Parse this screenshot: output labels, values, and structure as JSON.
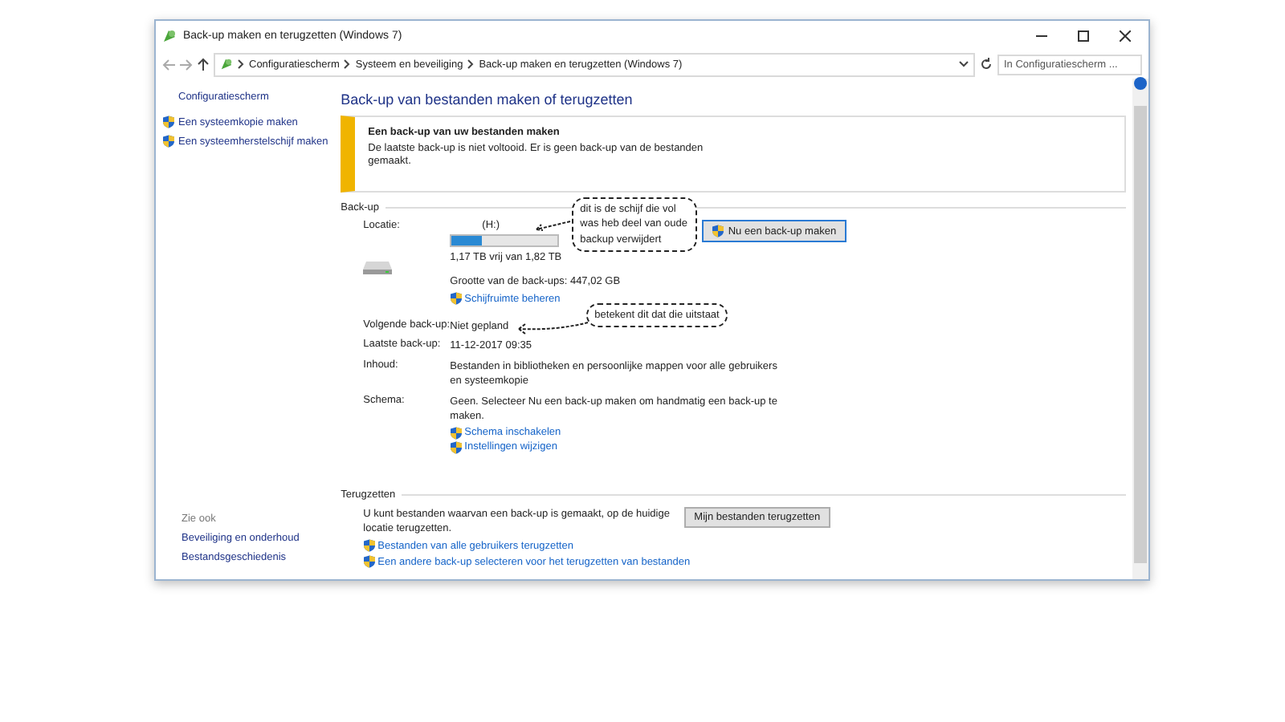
{
  "window": {
    "title": "Back-up maken en terugzetten (Windows 7)"
  },
  "address_bar": {
    "breadcrumbs": [
      "Configuratiescherm",
      "Systeem en beveiliging",
      "Back-up maken en terugzetten (Windows 7)"
    ],
    "search": {
      "placeholder": "In Configuratiescherm ..."
    }
  },
  "sidebar": {
    "home_link": "Configuratiescherm",
    "tasks": [
      "Een systeemkopie maken",
      "Een systeemherstelschijf maken"
    ],
    "see_also": {
      "heading": "Zie ook",
      "links": [
        "Beveiliging en onderhoud",
        "Bestandsgeschiedenis"
      ]
    }
  },
  "main": {
    "heading": "Back-up van bestanden maken of terugzetten",
    "notice": {
      "title": "Een back-up van uw bestanden maken",
      "message": "De laatste back-up is niet voltooid. Er is geen back-up van de bestanden gemaakt."
    },
    "backup": {
      "heading": "Back-up",
      "location_label": "Locatie:",
      "drive": "(H:)",
      "level": 0.28,
      "free_space": "1,17 TB vrij van 1,82 TB",
      "backup_size": "Grootte van de back-ups: 447,02 GB",
      "manage_link": "Schijfruimte beheren",
      "button": "Nu een back-up maken",
      "rows": [
        {
          "label": "Volgende back-up:",
          "value": "Niet gepland"
        },
        {
          "label": "Laatste back-up:",
          "value": "11-12-2017 09:35"
        },
        {
          "label": "Inhoud:",
          "value": "Bestanden in bibliotheken en persoonlijke mappen voor alle gebruikers en systeemkopie"
        },
        {
          "label": "Schema:",
          "value": "Geen. Selecteer Nu een back-up maken om handmatig een back-up te maken.",
          "links": [
            "Schema inschakelen",
            "Instellingen wijzigen"
          ]
        }
      ]
    },
    "restore": {
      "heading": "Terugzetten",
      "message": "U kunt bestanden waarvan een back-up is gemaakt, op de huidige locatie terugzetten.",
      "button": "Mijn bestanden terugzetten",
      "links": [
        "Bestanden van alle gebruikers terugzetten",
        "Een andere back-up selecteren voor het terugzetten van bestanden"
      ]
    }
  },
  "annotations": [
    {
      "text": "dit is de schijf die vol was heb deel van oude backup verwijdert"
    },
    {
      "text": "betekent dit dat die uitstaat"
    }
  ]
}
